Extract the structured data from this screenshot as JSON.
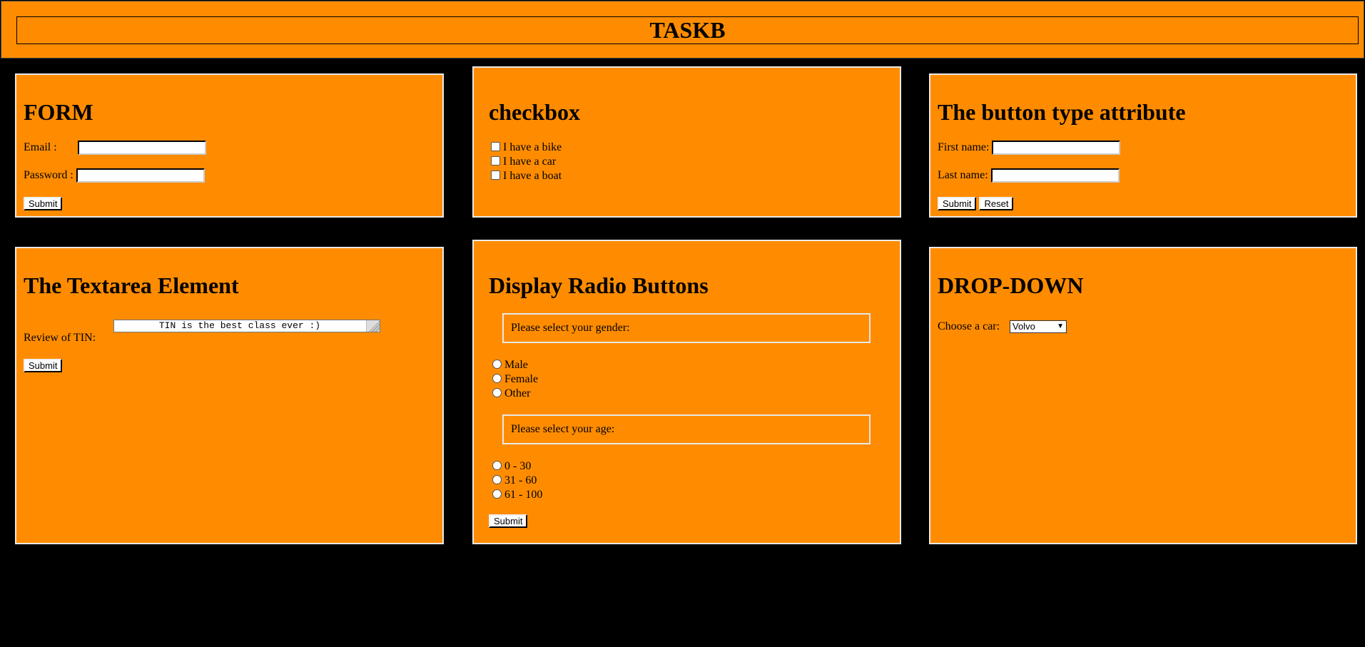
{
  "header": {
    "title": "TASKB"
  },
  "form": {
    "title": "FORM",
    "email_label": "Email :",
    "password_label": "Password :",
    "submit_label": "Submit"
  },
  "checkbox": {
    "title": "checkbox",
    "items": [
      "I have a bike",
      "I have a car",
      "I have a boat"
    ]
  },
  "button_type": {
    "title": "The button type attribute",
    "first_name_label": "First name:",
    "last_name_label": "Last name:",
    "submit_label": "Submit",
    "reset_label": "Reset"
  },
  "textarea": {
    "title": "The Textarea Element",
    "label": "Review of TIN:",
    "value": "TIN is the best class ever :)",
    "submit_label": "Submit"
  },
  "radio": {
    "title": "Display Radio Buttons",
    "gender_legend": "Please select your gender:",
    "gender_options": [
      "Male",
      "Female",
      "Other"
    ],
    "age_legend": "Please select your age:",
    "age_options": [
      "0 - 30",
      "31 - 60",
      "61 - 100"
    ],
    "submit_label": "Submit"
  },
  "dropdown": {
    "title": "DROP-DOWN",
    "label": "Choose a car:",
    "selected": "Volvo"
  },
  "colors": {
    "panel_bg": "#ff8c00",
    "page_bg": "#000000",
    "panel_border": "#e8e8e8"
  }
}
